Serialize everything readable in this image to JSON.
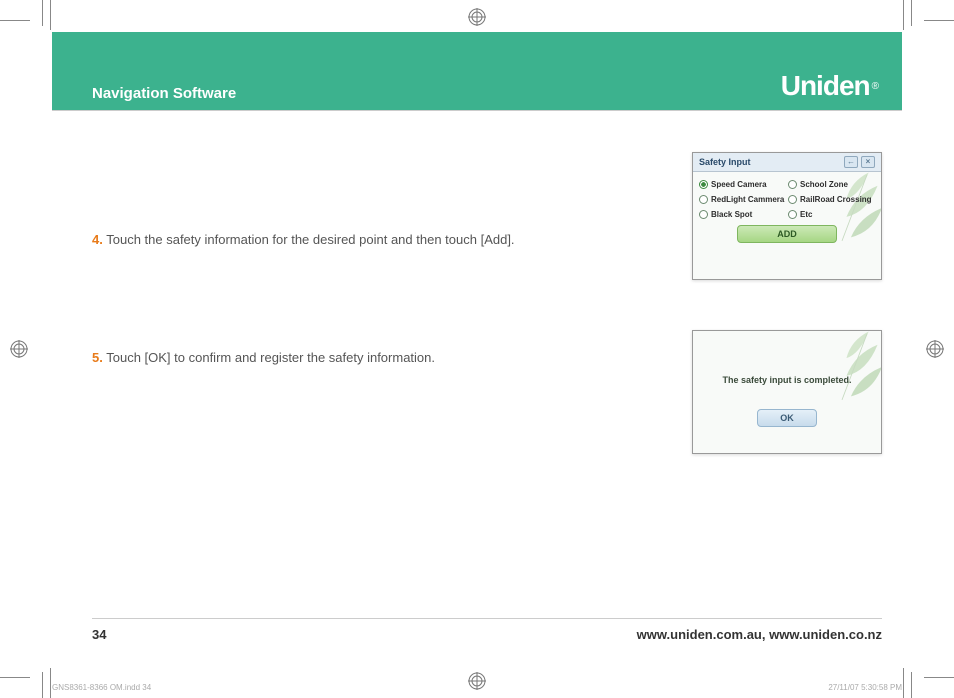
{
  "header": {
    "title": "Navigation Software",
    "brand": "Uniden"
  },
  "steps": {
    "s4": {
      "num": "4.",
      "text": "Touch the safety information for the desired point and then touch [Add]."
    },
    "s5": {
      "num": "5.",
      "text": "Touch [OK] to confirm and register the safety information."
    }
  },
  "panel1": {
    "title": "Safety Input",
    "options": {
      "o1": "Speed Camera",
      "o2": "School Zone",
      "o3": "RedLight Cammera",
      "o4": "RailRoad Crossing",
      "o5": "Black Spot",
      "o6": "Etc"
    },
    "add": "ADD"
  },
  "panel2": {
    "msg": "The safety input is completed.",
    "ok": "OK"
  },
  "footer": {
    "page": "34",
    "urls": "www.uniden.com.au, www.uniden.co.nz"
  },
  "slug": {
    "file": "GNS8361-8366 OM.indd   34",
    "stamp": "27/11/07   5:30:58 PM"
  }
}
